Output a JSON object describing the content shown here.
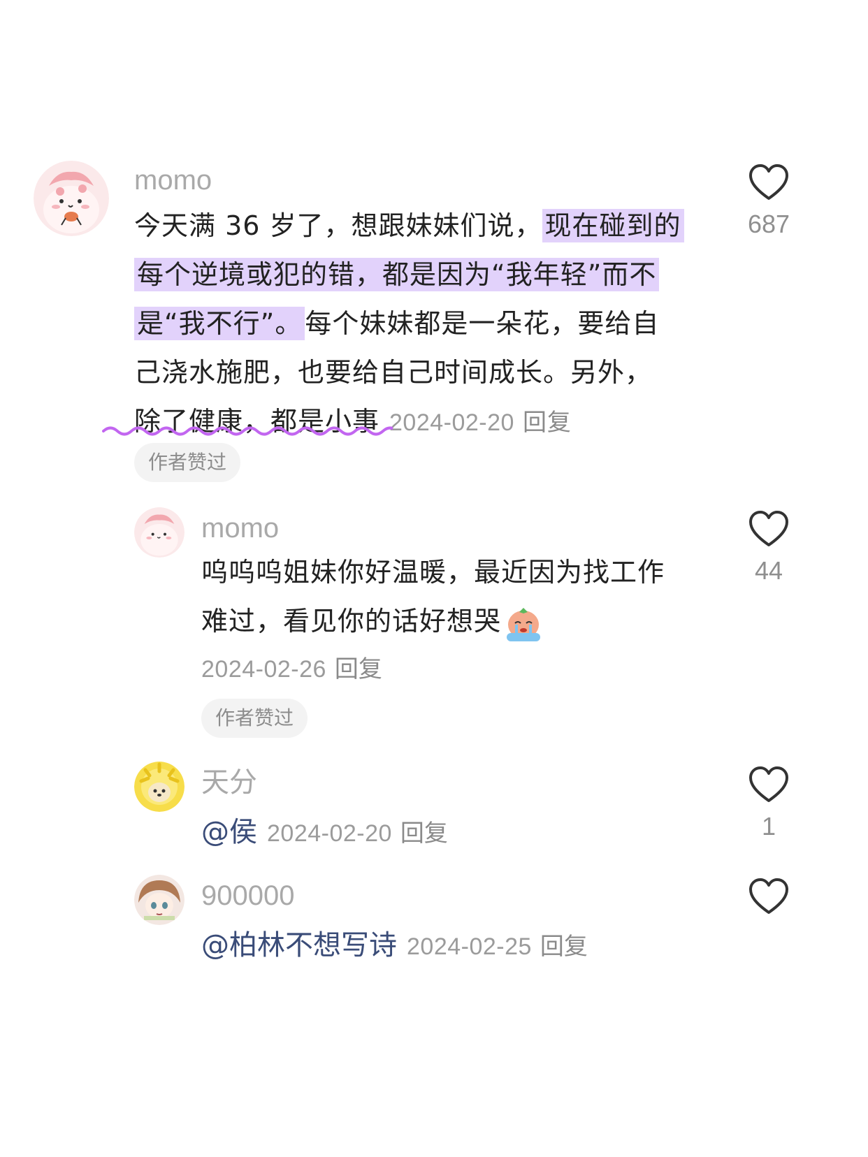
{
  "comments": [
    {
      "username": "momo",
      "text_lines": [
        "今天满 36 岁了，想跟妹妹们说，",
        "现在碰到的",
        "每个逆境或犯的错，都是因为“我年轻”而不",
        "是“我不行”。",
        "每个妹妹都是一朵花，要给自",
        "己浇水施肥，也要给自己时间成长。另外，",
        "除了健康，都是小事"
      ],
      "date": "2024-02-20",
      "reply_label": "回复",
      "badge": "作者赞过",
      "likes": "687"
    },
    {
      "username": "momo",
      "text_lines": [
        "呜呜呜姐妹你好温暖，最近因为找工作",
        "难过，看见你的话好想哭"
      ],
      "date": "2024-02-26",
      "reply_label": "回复",
      "badge": "作者赞过",
      "likes": "44"
    },
    {
      "username": "天分",
      "mention": "@侯",
      "date": "2024-02-20",
      "reply_label": "回复",
      "likes": "1"
    },
    {
      "username": "900000",
      "mention": "@柏林不想写诗",
      "date": "2024-02-25",
      "reply_label": "回复",
      "likes": ""
    }
  ],
  "colors": {
    "highlight": "#e2d2fb",
    "squiggle": "#c266f0",
    "username": "#a9a9a9",
    "meta": "#9b9b9b",
    "mention": "#3a4c78",
    "badge_bg": "#f3f3f3"
  },
  "icons": {
    "like": "heart-outline-icon",
    "emoji": "crying-emoji-icon"
  }
}
